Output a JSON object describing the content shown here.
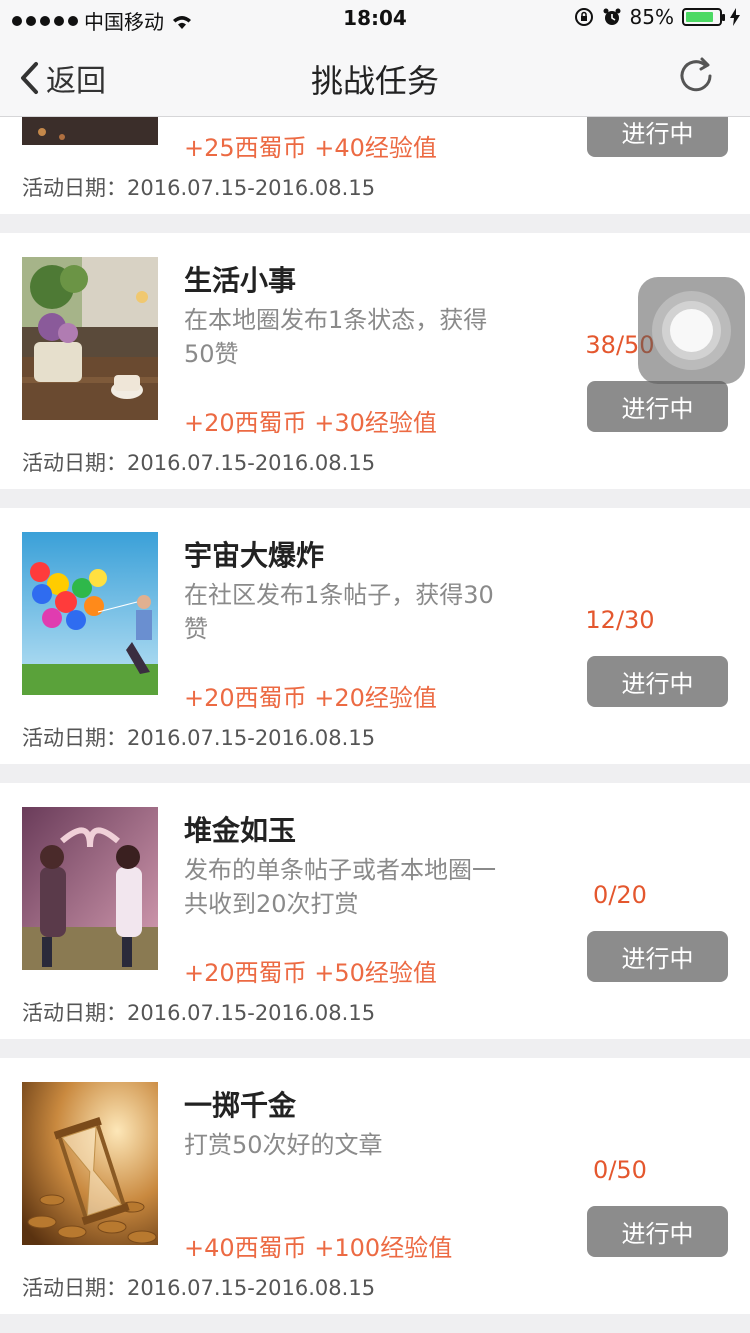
{
  "status_bar": {
    "carrier": "中国移动",
    "time": "18:04",
    "battery_percent": "85%",
    "battery_level": 0.85
  },
  "nav": {
    "back_label": "返回",
    "title": "挑战任务",
    "refresh_icon": "refresh-icon"
  },
  "tasks": [
    {
      "title": "",
      "description": "",
      "reward": "+25西蜀币 +40经验值",
      "progress": "",
      "status": "进行中",
      "date_label": "活动日期：",
      "date_range": "2016.07.15-2016.08.15"
    },
    {
      "title": "生活小事",
      "description": "在本地圈发布1条状态，获得50赞",
      "reward": "+20西蜀币 +30经验值",
      "progress": "38/50",
      "status": "进行中",
      "date_label": "活动日期：",
      "date_range": "2016.07.15-2016.08.15"
    },
    {
      "title": "宇宙大爆炸",
      "description": "在社区发布1条帖子，获得30赞",
      "reward": "+20西蜀币 +20经验值",
      "progress": "12/30",
      "status": "进行中",
      "date_label": "活动日期：",
      "date_range": "2016.07.15-2016.08.15"
    },
    {
      "title": "堆金如玉",
      "description": "发布的单条帖子或者本地圈一共收到20次打赏",
      "reward": "+20西蜀币 +50经验值",
      "progress": "0/20",
      "status": "进行中",
      "date_label": "活动日期：",
      "date_range": "2016.07.15-2016.08.15"
    },
    {
      "title": "一掷千金",
      "description": "打赏50次好的文章",
      "reward": "+40西蜀币 +100经验值",
      "progress": "0/50",
      "status": "进行中",
      "date_label": "活动日期：",
      "date_range": "2016.07.15-2016.08.15"
    }
  ],
  "colors": {
    "accent": "#ec6a43",
    "button_gray": "#8c8c8c",
    "background": "#efeff1"
  }
}
